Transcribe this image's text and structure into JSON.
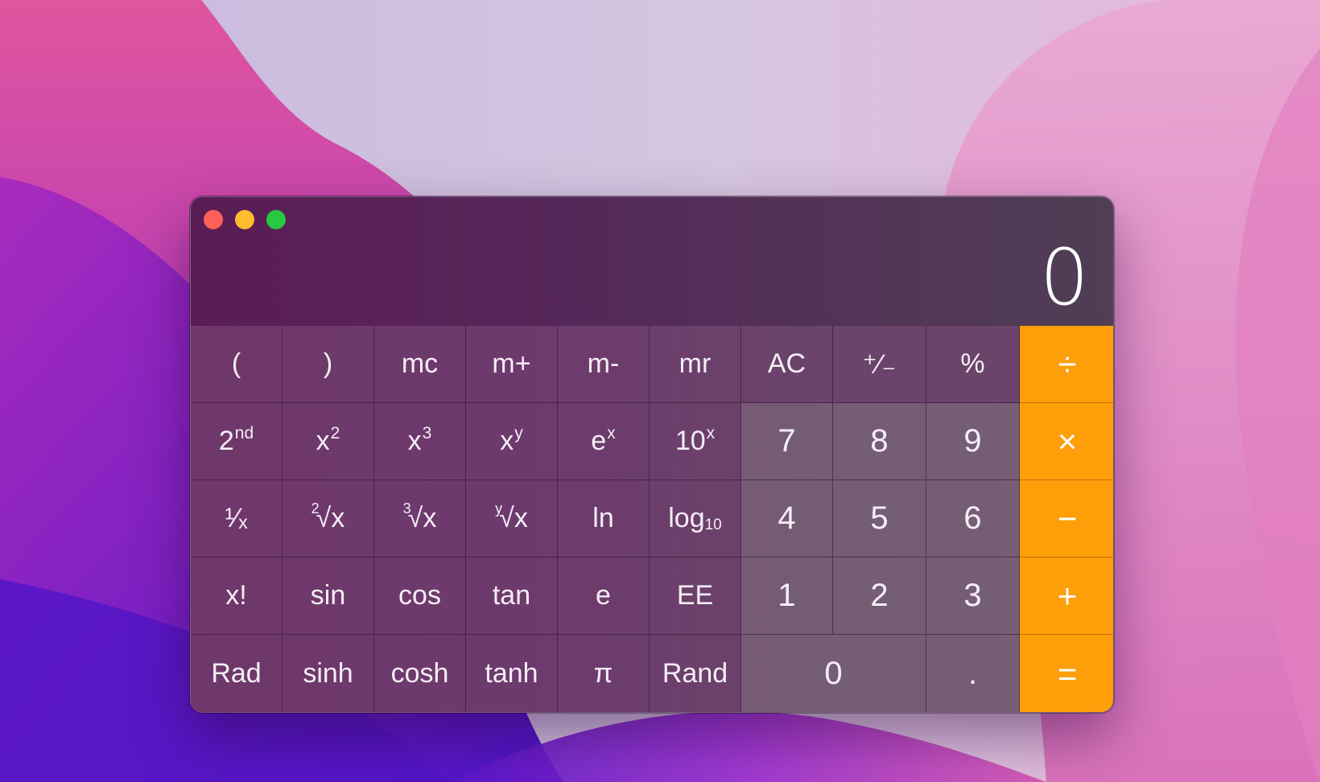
{
  "window": {
    "controls": {
      "close": "close",
      "minimize": "minimize",
      "maximize": "maximize"
    }
  },
  "display": {
    "value": "0"
  },
  "keys": {
    "open_paren": "(",
    "close_paren": ")",
    "mc": "mc",
    "m_plus": "m+",
    "m_minus": "m-",
    "mr": "mr",
    "ac": "AC",
    "plus_minus": "⁺∕₋",
    "percent": "%",
    "divide": "÷",
    "second_base": "2",
    "second_sup": "nd",
    "x_squared_base": "x",
    "x_squared_sup": "2",
    "x_cubed_base": "x",
    "x_cubed_sup": "3",
    "x_pow_y_base": "x",
    "x_pow_y_sup": "y",
    "e_pow_x_base": "e",
    "e_pow_x_sup": "x",
    "ten_pow_x_base": "10",
    "ten_pow_x_sup": "x",
    "seven": "7",
    "eight": "8",
    "nine": "9",
    "multiply": "×",
    "reciprocal": "¹∕ₓ",
    "sqrt2_index": "2",
    "sqrt2_body": "√x",
    "sqrt3_index": "3",
    "sqrt3_body": "√x",
    "sqrty_index": "y",
    "sqrty_body": "√x",
    "ln": "ln",
    "log10_base": "log",
    "log10_sub": "10",
    "four": "4",
    "five": "5",
    "six": "6",
    "minus": "−",
    "factorial": "x!",
    "sin": "sin",
    "cos": "cos",
    "tan": "tan",
    "e": "e",
    "ee": "EE",
    "one": "1",
    "two": "2",
    "three": "3",
    "plus": "+",
    "rad": "Rad",
    "sinh": "sinh",
    "cosh": "cosh",
    "tanh": "tanh",
    "pi": "π",
    "rand": "Rand",
    "zero": "0",
    "decimal": ".",
    "equals": "="
  },
  "colors": {
    "operator": "#fe9f0a",
    "close": "#fe5f57",
    "minimize": "#febc2e",
    "maximize": "#28c840"
  }
}
